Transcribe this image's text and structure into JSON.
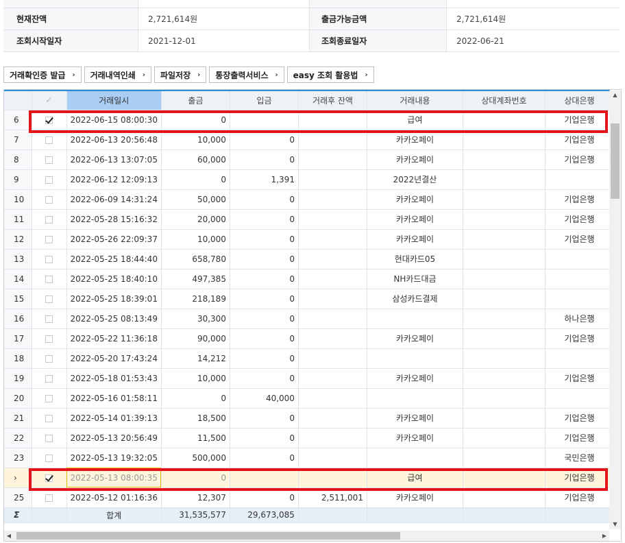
{
  "summary": {
    "rows": [
      {
        "label1": "현재잔액",
        "value1": "2,721,614원",
        "label2": "출금가능금액",
        "value2": "2,721,614원"
      },
      {
        "label1": "조회시작일자",
        "value1": "2021-12-01",
        "label2": "조회종료일자",
        "value2": "2022-06-21"
      }
    ]
  },
  "toolbar": {
    "buttons": [
      "거래확인증 발급",
      "거래내역인쇄",
      "파일저장",
      "통장출력서비스",
      "easy 조회 활용법"
    ]
  },
  "grid": {
    "headers": [
      "",
      "",
      "거래일시",
      "출금",
      "입금",
      "거래후 잔액",
      "거래내용",
      "상대계좌번호",
      "상대은행"
    ],
    "rows": [
      {
        "no": "6",
        "checked": true,
        "date": "2022-06-15 08:00:30",
        "out": "0",
        "in": "",
        "balance": "",
        "desc": "급여",
        "acct": "",
        "bank": "기업은행"
      },
      {
        "no": "7",
        "checked": false,
        "date": "2022-06-13 20:56:48",
        "out": "10,000",
        "in": "0",
        "balance": "",
        "desc": "카카오페이",
        "acct": "",
        "bank": "기업은행"
      },
      {
        "no": "8",
        "checked": false,
        "date": "2022-06-13 13:07:05",
        "out": "60,000",
        "in": "0",
        "balance": "",
        "desc": "카카오페이",
        "acct": "",
        "bank": "기업은행"
      },
      {
        "no": "9",
        "checked": false,
        "date": "2022-06-12 12:09:13",
        "out": "0",
        "in": "1,391",
        "balance": "",
        "desc": "2022년결산",
        "acct": "",
        "bank": ""
      },
      {
        "no": "10",
        "checked": false,
        "date": "2022-06-09 14:31:24",
        "out": "50,000",
        "in": "0",
        "balance": "",
        "desc": "카카오페이",
        "acct": "",
        "bank": "기업은행"
      },
      {
        "no": "11",
        "checked": false,
        "date": "2022-05-28 15:16:32",
        "out": "20,000",
        "in": "0",
        "balance": "",
        "desc": "카카오페이",
        "acct": "",
        "bank": "기업은행"
      },
      {
        "no": "12",
        "checked": false,
        "date": "2022-05-26 22:09:37",
        "out": "10,000",
        "in": "0",
        "balance": "",
        "desc": "카카오페이",
        "acct": "",
        "bank": "기업은행"
      },
      {
        "no": "13",
        "checked": false,
        "date": "2022-05-25 18:44:40",
        "out": "658,780",
        "in": "0",
        "balance": "",
        "desc": "현대카드05",
        "acct": "",
        "bank": ""
      },
      {
        "no": "14",
        "checked": false,
        "date": "2022-05-25 18:40:10",
        "out": "497,385",
        "in": "0",
        "balance": "",
        "desc": "NH카드대금",
        "acct": "",
        "bank": ""
      },
      {
        "no": "15",
        "checked": false,
        "date": "2022-05-25 18:39:01",
        "out": "218,189",
        "in": "0",
        "balance": "",
        "desc": "삼성카드결제",
        "acct": "",
        "bank": ""
      },
      {
        "no": "16",
        "checked": false,
        "date": "2022-05-25 08:13:49",
        "out": "30,300",
        "in": "0",
        "balance": "",
        "desc": "",
        "acct": "",
        "bank": "하나은행"
      },
      {
        "no": "17",
        "checked": false,
        "date": "2022-05-22 11:36:18",
        "out": "90,000",
        "in": "0",
        "balance": "",
        "desc": "카카오페이",
        "acct": "",
        "bank": "기업은행"
      },
      {
        "no": "18",
        "checked": false,
        "date": "2022-05-20 17:43:24",
        "out": "14,212",
        "in": "0",
        "balance": "",
        "desc": "",
        "acct": "",
        "bank": ""
      },
      {
        "no": "19",
        "checked": false,
        "date": "2022-05-18 01:53:43",
        "out": "10,000",
        "in": "0",
        "balance": "",
        "desc": "카카오페이",
        "acct": "",
        "bank": "기업은행"
      },
      {
        "no": "20",
        "checked": false,
        "date": "2022-05-16 01:58:11",
        "out": "0",
        "in": "40,000",
        "balance": "",
        "desc": "",
        "acct": "",
        "bank": ""
      },
      {
        "no": "21",
        "checked": false,
        "date": "2022-05-14 01:39:13",
        "out": "18,500",
        "in": "0",
        "balance": "",
        "desc": "카카오페이",
        "acct": "",
        "bank": "기업은행"
      },
      {
        "no": "22",
        "checked": false,
        "date": "2022-05-13 20:56:49",
        "out": "11,500",
        "in": "0",
        "balance": "",
        "desc": "카카오페이",
        "acct": "",
        "bank": "기업은행"
      },
      {
        "no": "23",
        "checked": false,
        "date": "2022-05-13 19:32:05",
        "out": "500,000",
        "in": "0",
        "balance": "",
        "desc": "",
        "acct": "",
        "bank": "국민은행"
      },
      {
        "no": "›",
        "checked": true,
        "date": "2022-05-13 08:00:35",
        "out": "0",
        "in": "",
        "balance": "",
        "desc": "급여",
        "acct": "",
        "bank": "기업은행",
        "current": true
      },
      {
        "no": "25",
        "checked": false,
        "date": "2022-05-12 01:16:36",
        "out": "12,307",
        "in": "0",
        "balance": "2,511,001",
        "desc": "카카오페이",
        "acct": "",
        "bank": "기업은행"
      }
    ],
    "footer": {
      "sigma": "Σ",
      "label": "합계",
      "out": "31,535,577",
      "in": "29,673,085"
    }
  },
  "colors": {
    "accent": "#2a8fd9",
    "highlight": "#e3141b",
    "selected_header": "#a9cdf3"
  }
}
